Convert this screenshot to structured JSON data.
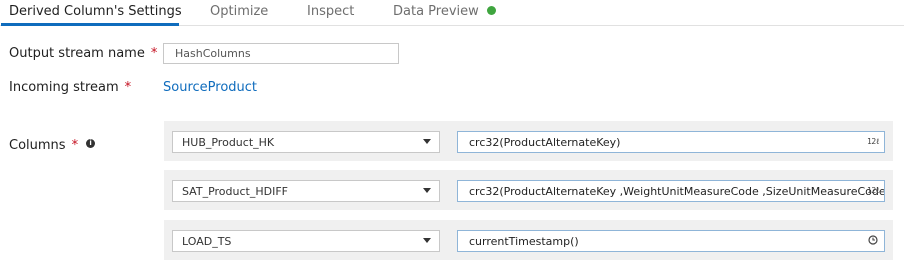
{
  "tabs": [
    {
      "label": "Derived Column's Settings",
      "active": true
    },
    {
      "label": "Optimize",
      "active": false
    },
    {
      "label": "Inspect",
      "active": false
    },
    {
      "label": "Data Preview",
      "active": false,
      "status_dot_color": "#3fa53f"
    }
  ],
  "form": {
    "output_stream_label": "Output stream name",
    "output_stream_value": "HashColumns",
    "incoming_stream_label": "Incoming stream",
    "incoming_stream_value": "SourceProduct",
    "columns_label": "Columns",
    "required_marker": "*",
    "info_icon": "i"
  },
  "columns": [
    {
      "name": "HUB_Product_HK",
      "expression": "crc32(ProductAlternateKey)",
      "type_icon": "12ℓ"
    },
    {
      "name": "SAT_Product_HDIFF",
      "expression": "crc32(ProductAlternateKey ,WeightUnitMeasureCode ,SizeUnitMeasureCode",
      "type_icon": "12ℓ"
    },
    {
      "name": "LOAD_TS",
      "expression": "currentTimestamp()",
      "type_icon": "clock"
    }
  ],
  "colors": {
    "accent": "#0f6cbd",
    "required": "#c50f1f",
    "row_bg": "#f0f0f0"
  }
}
